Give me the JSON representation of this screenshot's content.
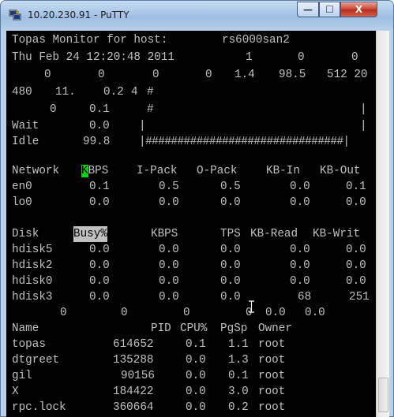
{
  "window": {
    "title": "10.20.230.91 - PuTTY"
  },
  "controls": {
    "minimize": "—",
    "maximize": "☐",
    "close": "X"
  },
  "terminal": {
    "header": {
      "title": "Topas Monitor for host:",
      "host": "rs6000san2"
    },
    "date_line": [
      "Thu Feb 24 12:20:48 2011",
      "1",
      "0",
      "0"
    ],
    "zero_line": [
      "0",
      "0",
      "0",
      "0",
      "1.4",
      "98.5",
      "512 20"
    ],
    "row_480": [
      "480",
      "11.",
      "0.2",
      "4",
      "#"
    ],
    "row_0": [
      "0",
      "0.1",
      "#",
      "|"
    ],
    "wait": {
      "label": "Wait",
      "value": "0.0",
      "bar": "|",
      "end": "|"
    },
    "idle": {
      "label": "Idle",
      "value": "99.8",
      "bar": "|###############################|"
    },
    "network": {
      "headers": [
        "Network",
        "KBPS",
        "I-Pack",
        "O-Pack",
        "KB-In",
        "KB-Out"
      ],
      "rows": [
        [
          "en0",
          "0.1",
          "0.5",
          "0.5",
          "0.0",
          "0.1"
        ],
        [
          "lo0",
          "0.0",
          "0.0",
          "0.0",
          "0.0",
          "0.0"
        ]
      ]
    },
    "disk": {
      "headers": [
        "Disk",
        "Busy%",
        "KBPS",
        "TPS",
        "KB-Read",
        "KB-Writ"
      ],
      "rows": [
        [
          "hdisk5",
          "0.0",
          "0.0",
          "0.0",
          "0.0",
          "0.0"
        ],
        [
          "hdisk2",
          "0.0",
          "0.0",
          "0.0",
          "0.0",
          "0.0"
        ],
        [
          "hdisk0",
          "0.0",
          "0.0",
          "0.0",
          "0.0",
          "0.0"
        ],
        [
          "hdisk3",
          "0.0",
          "0.0",
          "0.0",
          "68",
          "251"
        ]
      ]
    },
    "misc_line": [
      "0",
      "0",
      "0",
      "0",
      "0.0",
      "0.0"
    ],
    "process": {
      "headers": [
        "Name",
        "PID",
        "CPU%",
        "PgSp",
        "Owner"
      ],
      "rows": [
        [
          "topas",
          "614652",
          "0.1",
          "1.1",
          "root"
        ],
        [
          "dtgreet",
          "135288",
          "0.0",
          "1.3",
          "root"
        ],
        [
          "gil",
          "90156",
          "0.0",
          "0.1",
          "root"
        ],
        [
          "X",
          "184422",
          "0.0",
          "3.0",
          "root"
        ],
        [
          "rpc.lock",
          "360664",
          "0.0",
          "0.2",
          "root"
        ]
      ]
    }
  }
}
